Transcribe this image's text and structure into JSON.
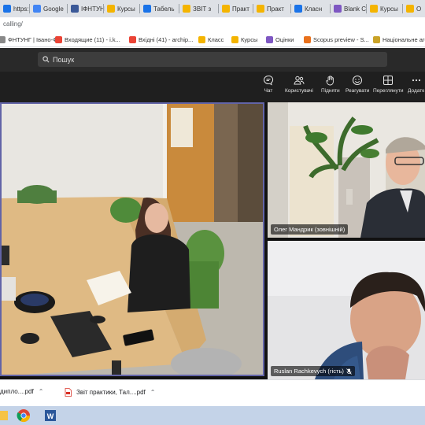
{
  "browser": {
    "tabs": [
      {
        "label": "https:",
        "color": "#1a73e8"
      },
      {
        "label": "Google",
        "color": "#4285f4"
      },
      {
        "label": "ІФНТУН",
        "color": "#3b5998"
      },
      {
        "label": "Курсы",
        "color": "#f4b400"
      },
      {
        "label": "Табель",
        "color": "#1a73e8"
      },
      {
        "label": "ЗВІТ з",
        "color": "#f4b400"
      },
      {
        "label": "Практ",
        "color": "#f4b400"
      },
      {
        "label": "Практ",
        "color": "#f4b400"
      },
      {
        "label": "Класн",
        "color": "#1a73e8"
      },
      {
        "label": "Blank C",
        "color": "#7e57c2"
      },
      {
        "label": "Курсы",
        "color": "#f4b400"
      },
      {
        "label": "О",
        "color": "#f4b400"
      }
    ],
    "address": "calling/",
    "bookmarks": [
      {
        "label": "ФНТУНГ | Івано-Ф...",
        "icon": "site-icon",
        "color": "#888888"
      },
      {
        "label": "Входящие (11) - i.k...",
        "icon": "gmail-icon",
        "color": "#ea4335"
      },
      {
        "label": "Вхідні (41) - archip...",
        "icon": "gmail-icon",
        "color": "#ea4335"
      },
      {
        "label": "Класс",
        "icon": "classroom-icon",
        "color": "#f4b400"
      },
      {
        "label": "Курсы",
        "icon": "classroom-icon",
        "color": "#f4b400"
      },
      {
        "label": "Оцінки",
        "icon": "grades-icon",
        "color": "#7e57c2"
      },
      {
        "label": "Scopus preview - S...",
        "icon": "scopus-icon",
        "color": "#e9711c"
      },
      {
        "label": "Національне аге",
        "icon": "agency-icon",
        "color": "#c9a227"
      }
    ]
  },
  "teams": {
    "search_placeholder": "Пошук",
    "toolbar": [
      {
        "label": "Чат",
        "icon": "chat-icon"
      },
      {
        "label": "Користувачі",
        "icon": "people-icon"
      },
      {
        "label": "Підняти",
        "icon": "raise-hand-icon"
      },
      {
        "label": "Реагувати",
        "icon": "smile-icon"
      },
      {
        "label": "Переглянути",
        "icon": "view-icon"
      },
      {
        "label": "Додатк",
        "icon": "more-icon"
      }
    ],
    "participants": [
      {
        "name": "Олег Мандрик (зовнішній)"
      },
      {
        "name": "Ruslan Rachkevych (гість)",
        "muted_icon": "mic-off-icon"
      }
    ],
    "active_speaker_color": "#6264a7"
  },
  "downloads": [
    {
      "label": "дипло....pdf",
      "icon": "pdf-icon"
    },
    {
      "label": "Звіт практики, Тал....pdf",
      "icon": "pdf-icon"
    }
  ]
}
